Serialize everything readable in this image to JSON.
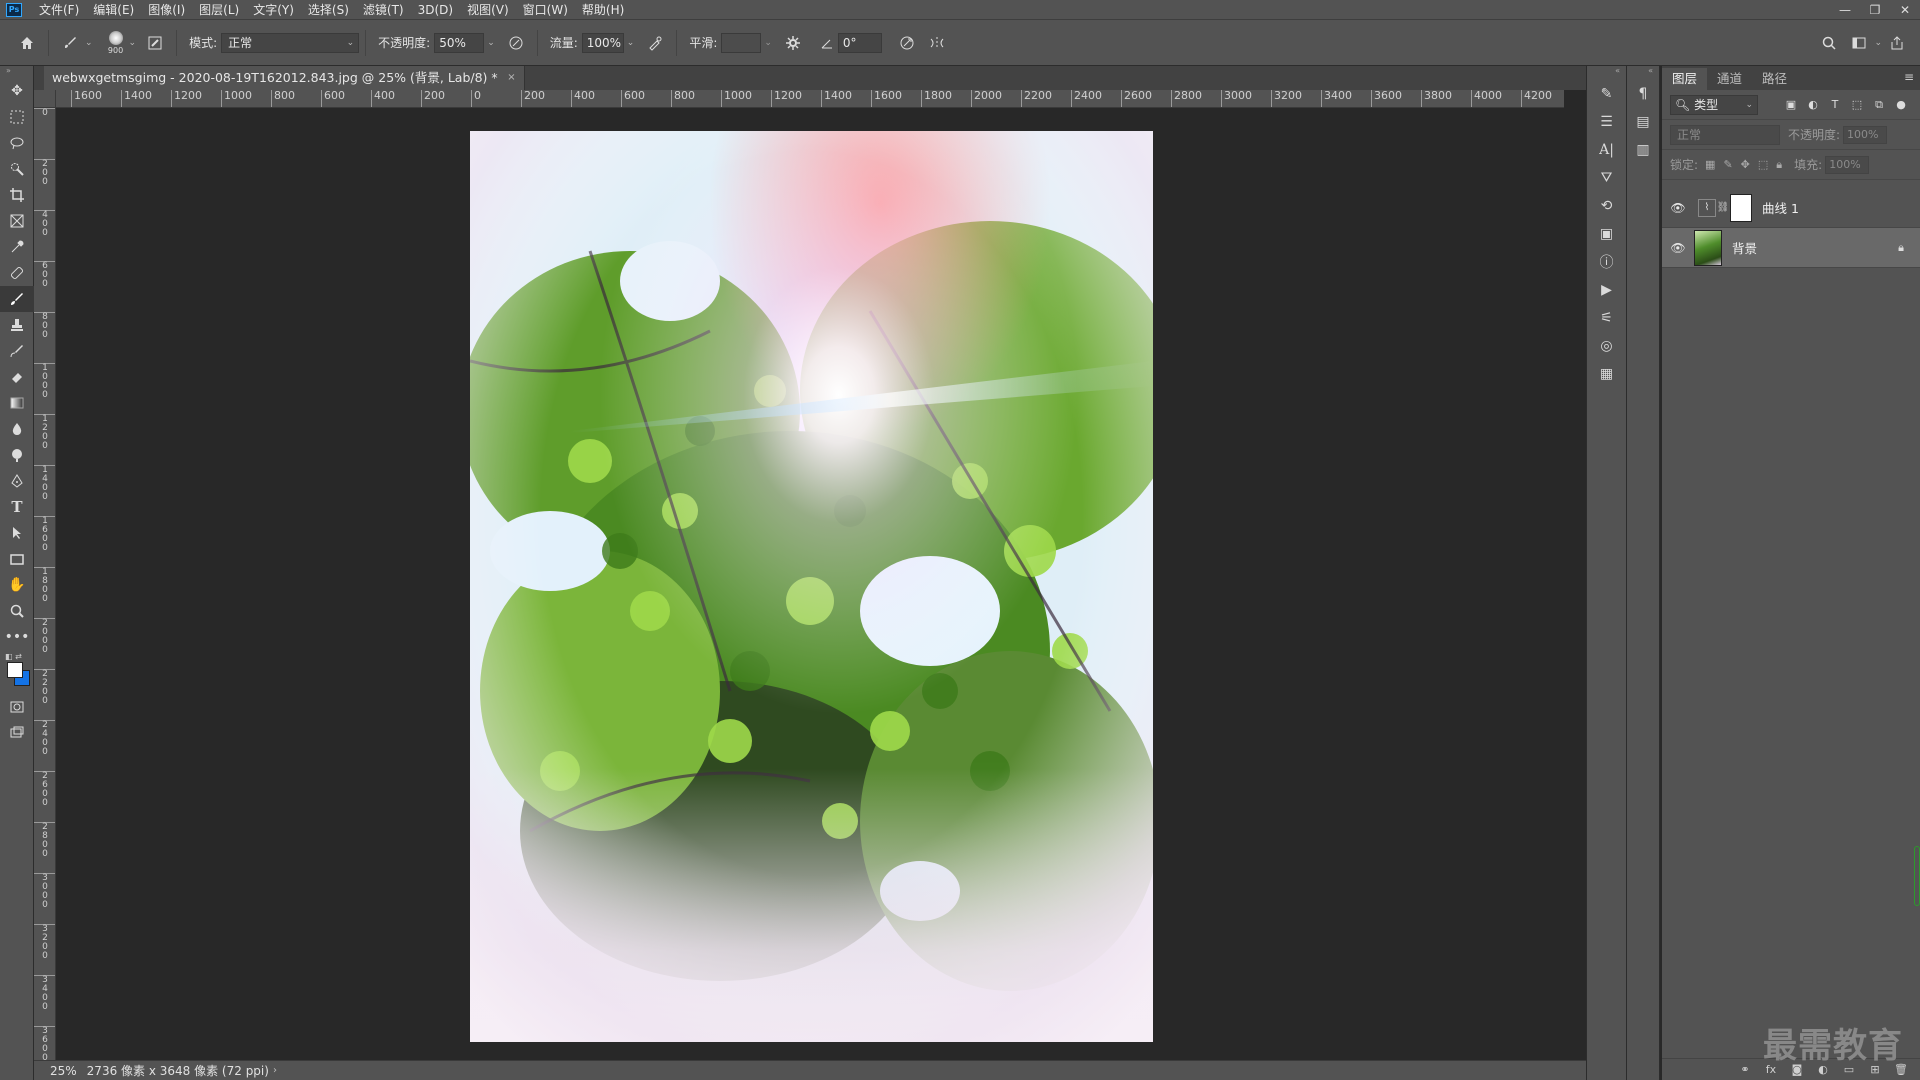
{
  "app": {
    "logo": "Ps",
    "menus": [
      "文件(F)",
      "编辑(E)",
      "图像(I)",
      "图层(L)",
      "文字(Y)",
      "选择(S)",
      "滤镜(T)",
      "3D(D)",
      "视图(V)",
      "窗口(W)",
      "帮助(H)"
    ],
    "window_controls": [
      "—",
      "❐",
      "✕"
    ]
  },
  "options": {
    "brush_size": "900",
    "mode_label": "模式:",
    "mode_value": "正常",
    "opacity_label": "不透明度:",
    "opacity_value": "50%",
    "flow_label": "流量:",
    "flow_value": "100%",
    "smooth_label": "平滑:",
    "smooth_value": "",
    "angle_value": "0°"
  },
  "document": {
    "tab_title": "webwxgetmsgimg - 2020-08-19T162012.843.jpg @ 25% (背景, Lab/8) *",
    "close": "×",
    "zoom": "25%",
    "size_info": "2736 像素 x 3648 像素 (72 ppi)"
  },
  "rulers": {
    "horizontal": [
      "1600",
      "1400",
      "1200",
      "1000",
      "800",
      "600",
      "400",
      "200",
      "0",
      "200",
      "400",
      "600",
      "800",
      "1000",
      "1200",
      "1400",
      "1600",
      "1800",
      "2000",
      "2200",
      "2400",
      "2600",
      "2800",
      "3000",
      "3200",
      "3400",
      "3600",
      "3800",
      "4000",
      "4200"
    ],
    "vertical": [
      "0",
      "2 0 0",
      "4 0 0",
      "6 0 0",
      "8 0 0",
      "1 0 0 0",
      "1 2 0 0",
      "1 4 0 0",
      "1 6 0 0",
      "1 8 0 0",
      "2 0 0 0",
      "2 2 0 0",
      "2 4 0 0",
      "2 6 0 0",
      "2 8 0 0",
      "3 0 0 0",
      "3 2 0 0",
      "3 4 0 0",
      "3 6 0 0"
    ]
  },
  "layers_panel": {
    "tabs": [
      "图层",
      "通道",
      "路径"
    ],
    "filter_label": "类型",
    "blend_mode": "正常",
    "opacity_label": "不透明度:",
    "opacity_value": "100%",
    "lock_label": "锁定:",
    "fill_label": "填充:",
    "fill_value": "100%",
    "layers": [
      {
        "name": "曲线 1",
        "type": "curves-adjustment",
        "visible": true,
        "selected": false
      },
      {
        "name": "背景",
        "type": "background",
        "visible": true,
        "selected": true,
        "locked": true
      }
    ]
  },
  "watermark": "最需教育",
  "colors": {
    "foreground": "#ffffff",
    "background": "#1473e6",
    "ui_dark": "#282828",
    "ui_panel": "#535353"
  }
}
